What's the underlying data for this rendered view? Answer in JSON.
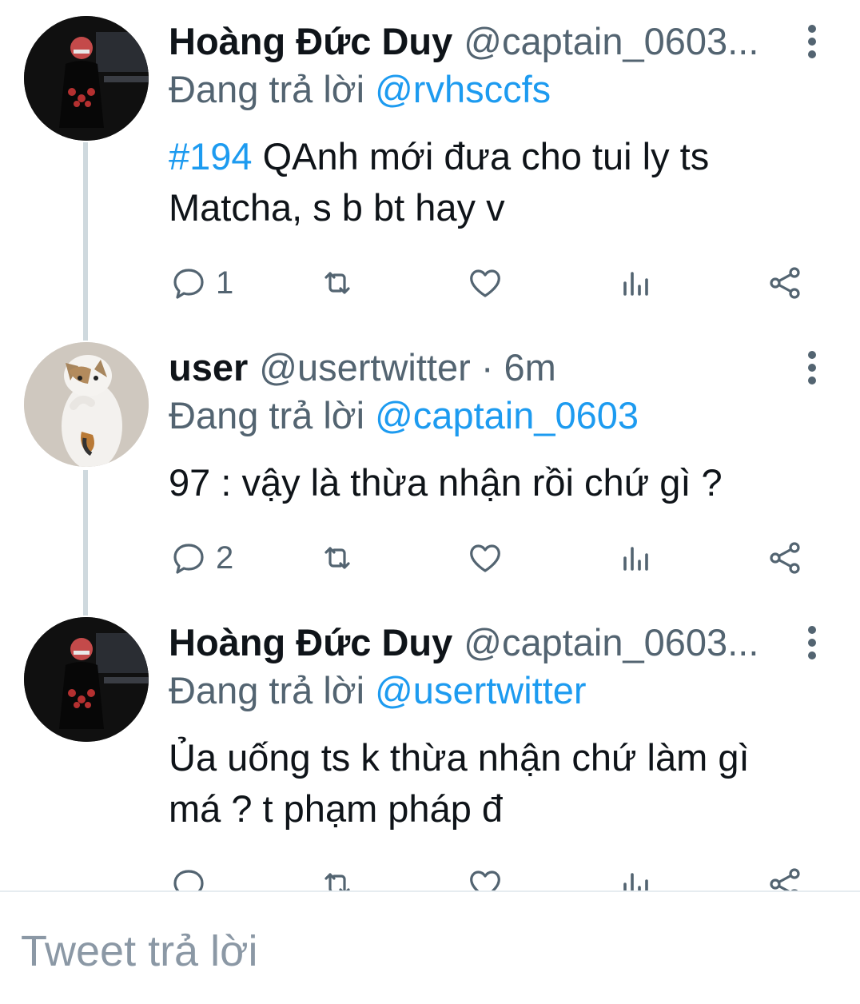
{
  "colors": {
    "accent": "#1d9bf0",
    "secondary_text": "#536471",
    "primary_text": "#0f1419",
    "thread_line": "#cfd9de"
  },
  "tweets": [
    {
      "name": "Hoàng Đức Duy",
      "handle": "@captain_0603...",
      "time": "",
      "replying_label": "Đang trả lời",
      "replying_to": "@rvhsccfs",
      "hashtag": "#194",
      "text_line1": " QAnh mới đưa cho tui ly ts",
      "text_line2": "Matcha, s b bt hay v",
      "reply_count": "1",
      "avatar": "user-avatar-dark"
    },
    {
      "name": "user",
      "handle": "@usertwitter · 6m",
      "replying_label": "Đang trả lời",
      "replying_to": "@captain_0603",
      "text_line1": "97 : vậy là thừa nhận rồi chứ gì ?",
      "reply_count": "2",
      "avatar": "cat-avatar"
    },
    {
      "name": "Hoàng Đức Duy",
      "handle": "@captain_0603...",
      "replying_label": "Đang trả lời",
      "replying_to": "@usertwitter",
      "text_line1": "Ủa uống ts k thừa nhận chứ làm gì",
      "text_line2": "má ? t phạm pháp đ",
      "reply_count": "",
      "avatar": "user-avatar-dark"
    }
  ],
  "icons": {
    "reply": "reply-icon",
    "retweet": "retweet-icon",
    "like": "heart-icon",
    "analytics": "analytics-icon",
    "share": "share-icon",
    "more": "more-vertical-icon"
  },
  "composer": {
    "placeholder": "Tweet trả lời"
  }
}
